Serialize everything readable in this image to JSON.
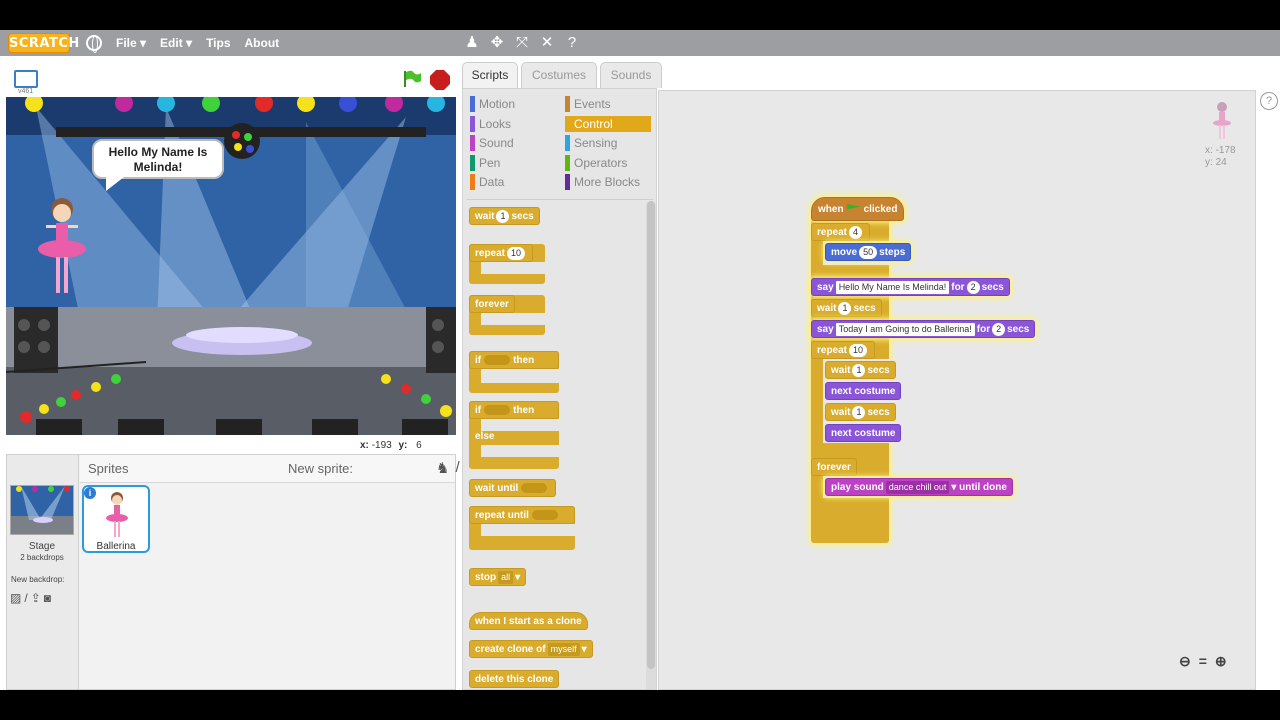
{
  "menubar": {
    "logo": "SCRATCH",
    "items": [
      "File ▾",
      "Edit ▾",
      "Tips",
      "About"
    ],
    "tools": [
      "person-icon",
      "duplicate-icon",
      "grow-icon",
      "shrink-icon",
      "help-icon"
    ]
  },
  "stage": {
    "version": "v461",
    "speech": "Hello My Name Is Melinda!",
    "coords_x_label": "x:",
    "coords_x": "-193",
    "coords_y_label": "y:",
    "coords_y": "6"
  },
  "sprites_pane": {
    "title": "Sprites",
    "new_sprite": "New sprite:",
    "stage_label": "Stage",
    "stage_sub": "2 backdrops",
    "new_backdrop": "New backdrop:",
    "sprite_name": "Ballerina"
  },
  "tabs": [
    "Scripts",
    "Costumes",
    "Sounds"
  ],
  "categories": {
    "left": [
      {
        "label": "Motion",
        "color": "#4a6cd4"
      },
      {
        "label": "Looks",
        "color": "#8a55d7"
      },
      {
        "label": "Sound",
        "color": "#bb42c3"
      },
      {
        "label": "Pen",
        "color": "#0e9a6c"
      },
      {
        "label": "Data",
        "color": "#ee7d16"
      }
    ],
    "right": [
      {
        "label": "Events",
        "color": "#c88330"
      },
      {
        "label": "Control",
        "color": "#e1a91a"
      },
      {
        "label": "Sensing",
        "color": "#2ca5e2"
      },
      {
        "label": "Operators",
        "color": "#5cb712"
      },
      {
        "label": "More Blocks",
        "color": "#632d99"
      }
    ]
  },
  "palette": {
    "wait": "wait",
    "wait_val": "1",
    "secs": "secs",
    "repeat": "repeat",
    "repeat_val": "10",
    "forever": "forever",
    "if": "if",
    "then": "then",
    "else": "else",
    "wait_until": "wait until",
    "repeat_until": "repeat until",
    "stop": "stop",
    "stop_val": "all",
    "clone_start": "when I start as a clone",
    "create_clone": "create clone of",
    "create_clone_val": "myself",
    "delete_clone": "delete this clone"
  },
  "script": {
    "when": "when",
    "clicked": "clicked",
    "repeat1": "repeat",
    "repeat1_val": "4",
    "move": "move",
    "move_val": "50",
    "steps": "steps",
    "say1": "say",
    "say1_text": "Hello My Name Is Melinda!",
    "say1_for": "for",
    "say1_secs_val": "2",
    "say1_secs": "secs",
    "wait1": "wait",
    "wait1_val": "1",
    "wait1_secs": "secs",
    "say2": "say",
    "say2_text": "Today I am Going to do Ballerina!",
    "say2_for": "for",
    "say2_secs_val": "2",
    "say2_secs": "secs",
    "repeat2": "repeat",
    "repeat2_val": "10",
    "wait2": "wait",
    "wait2_val": "1",
    "wait2_secs": "secs",
    "next1": "next costume",
    "wait3": "wait",
    "wait3_val": "1",
    "wait3_secs": "secs",
    "next2": "next costume",
    "forever": "forever",
    "play": "play sound",
    "play_val": "dance chill out",
    "until": "until done"
  },
  "script_area": {
    "x_label": "x:",
    "x": "-178",
    "y_label": "y:",
    "y": "24"
  }
}
